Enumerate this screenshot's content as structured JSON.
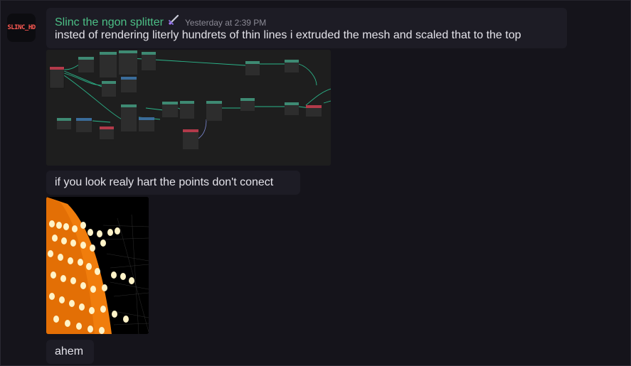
{
  "user": {
    "avatar_text": "SLINC_HD",
    "name": "Slinc the ngon splitter",
    "timestamp": "Yesterday at 2:39 PM"
  },
  "messages": [
    {
      "text": "insted of rendering literly hundrets of thin lines i extruded the mesh and scaled that to the top"
    },
    {
      "text": "if you look realy hart the points don't conect"
    },
    {
      "text": "ahem"
    }
  ],
  "colors": {
    "background": "#15141b",
    "bubble": "#1d1c25",
    "author": "#4cbf86",
    "timestamp": "#8b8a95",
    "text": "#e4e3ea",
    "node_wire": "#2bb58a",
    "render_orange": "#f07d0c"
  },
  "icons": {
    "badge": "sword-icon"
  }
}
